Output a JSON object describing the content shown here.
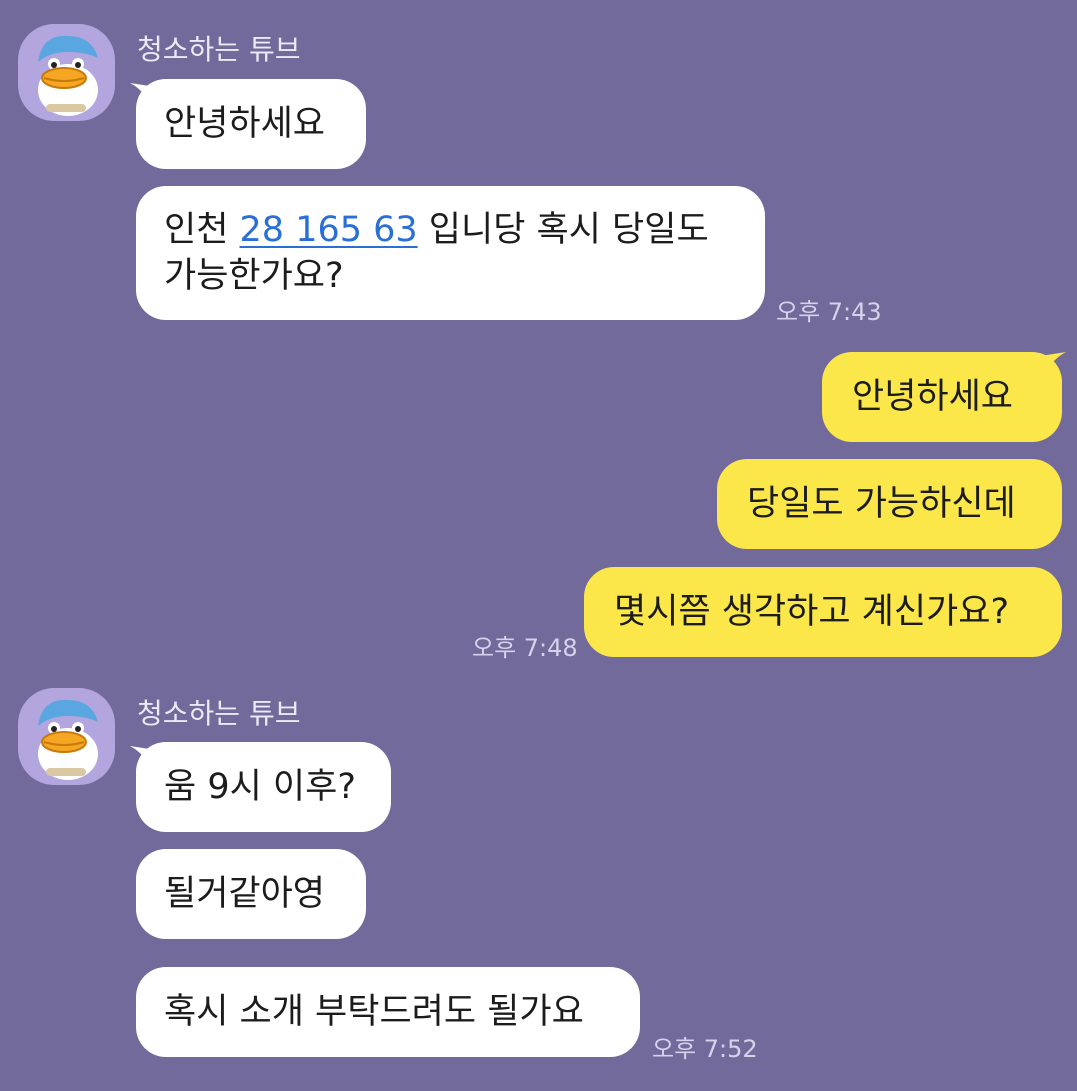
{
  "chat": {
    "groups": [
      {
        "sender": "청소하는 튜브",
        "messages": [
          {
            "text": "안녕하세요"
          },
          {
            "parts": [
              "인천 ",
              "28 165 63",
              " 입니당 혹시 당일도",
              "가능한가요?"
            ]
          }
        ],
        "time": "오후 7:43"
      },
      {
        "sender": "me",
        "messages": [
          {
            "text": "안녕하세요"
          },
          {
            "text": "당일도 가능하신데"
          },
          {
            "text": "몇시쯤 생각하고 계신가요?"
          }
        ],
        "time": "오후 7:48"
      },
      {
        "sender": "청소하는 튜브",
        "messages": [
          {
            "text": "움 9시 이후?"
          },
          {
            "text": "될거같아영"
          },
          {
            "text": "혹시 소개 부탁드려도 될가요"
          }
        ],
        "time": "오후 7:52"
      }
    ]
  },
  "colors": {
    "background": "#726a9b",
    "incoming_bubble": "#ffffff",
    "outgoing_bubble": "#fbe74a",
    "link": "#2a6fd6",
    "avatar_bg": "#b3a6df"
  },
  "icons": {
    "avatar": "tube-duck-character-icon"
  }
}
